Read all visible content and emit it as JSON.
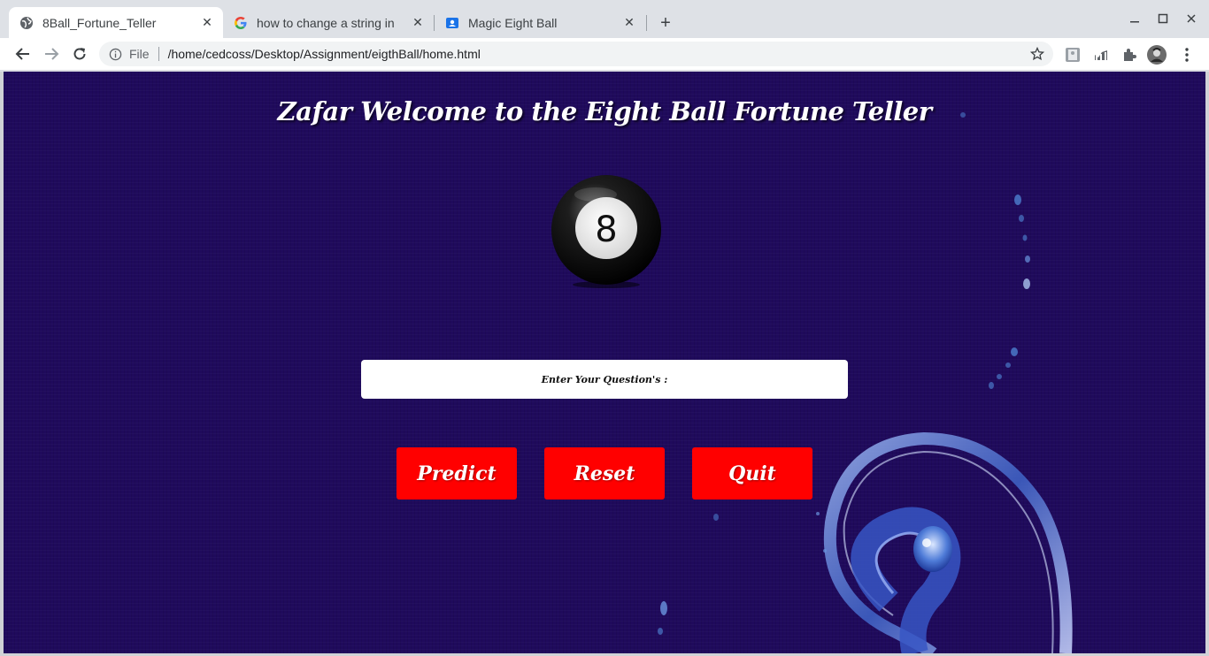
{
  "browser": {
    "tabs": [
      {
        "title": "8Ball_Fortune_Teller",
        "icon": "globe-icon",
        "active": true
      },
      {
        "title": "how to change a string in",
        "icon": "google-icon",
        "active": false
      },
      {
        "title": "Magic Eight Ball",
        "icon": "contact-icon",
        "active": false
      }
    ],
    "new_tab": "+",
    "omnibox": {
      "scheme_label": "File",
      "url": "/home/cedcoss/Desktop/Assignment/eigthBall/home.html"
    }
  },
  "page": {
    "heading": "Zafar Welcome to the Eight Ball Fortune Teller",
    "ball_number": "8",
    "question_placeholder": "Enter Your Question's :",
    "buttons": {
      "predict": "Predict",
      "reset": "Reset",
      "quit": "Quit"
    },
    "colors": {
      "background": "#1f0a5c",
      "button": "#ff0000",
      "heading": "#ffffff"
    }
  }
}
